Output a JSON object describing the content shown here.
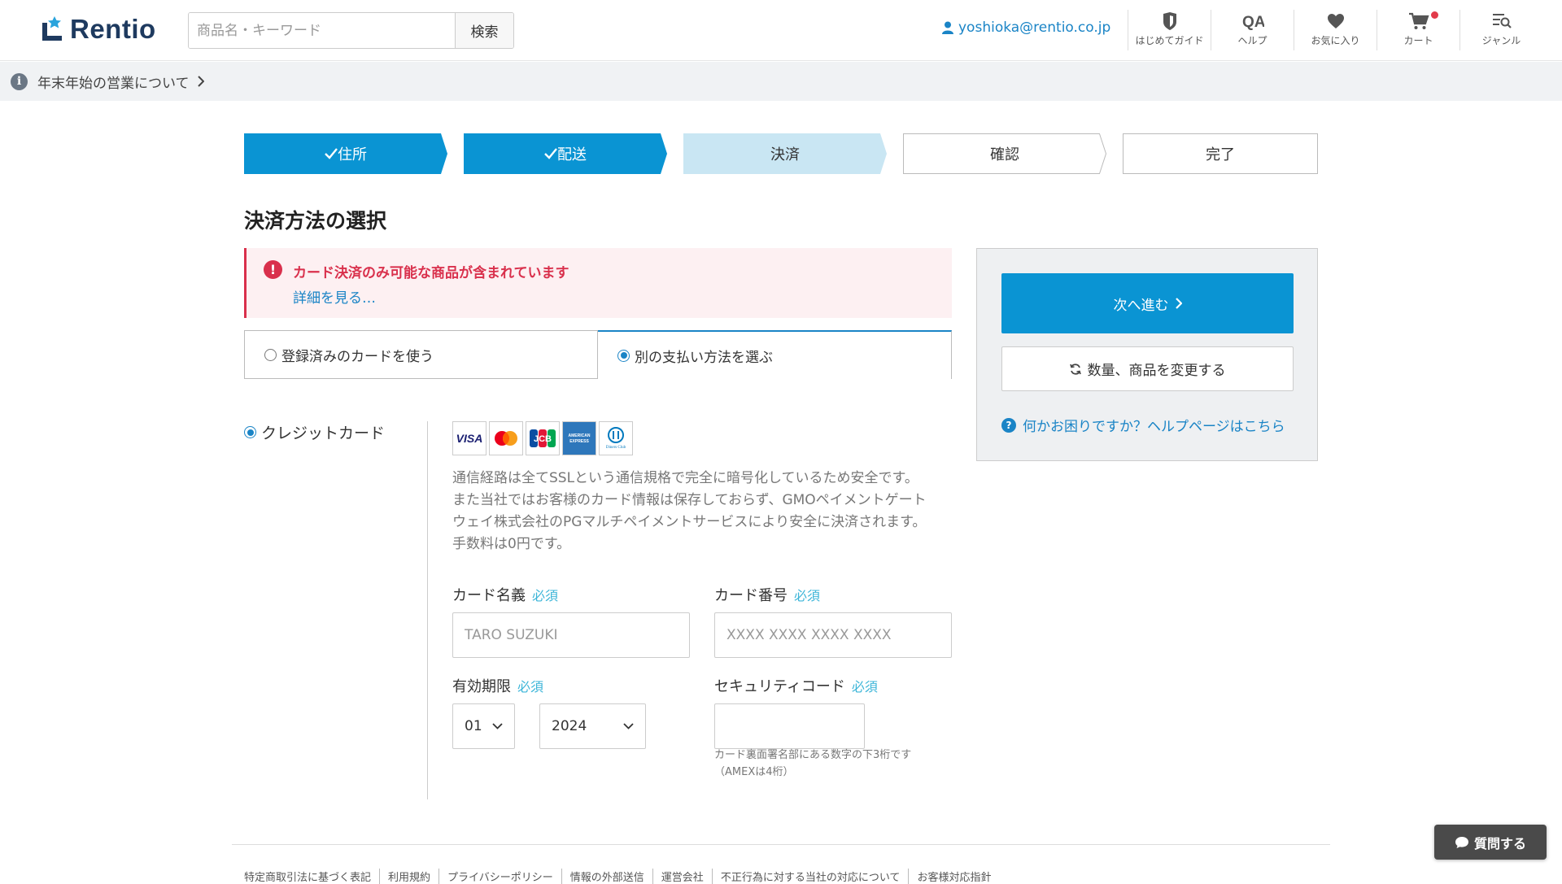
{
  "header": {
    "logo_text": "Rentio",
    "search_placeholder": "商品名・キーワード",
    "search_button": "検索",
    "user_email": "yoshioka@rentio.co.jp",
    "nav": [
      {
        "label": "はじめてガイド",
        "icon": "guide-shield-icon"
      },
      {
        "label": "ヘルプ",
        "icon": "qa-icon"
      },
      {
        "label": "お気に入り",
        "icon": "heart-icon"
      },
      {
        "label": "カート",
        "icon": "cart-icon",
        "badge": true
      },
      {
        "label": "ジャンル",
        "icon": "genre-list-icon"
      }
    ]
  },
  "notice": {
    "text": "年末年始の営業について"
  },
  "steps": [
    {
      "label": "住所",
      "state": "done"
    },
    {
      "label": "配送",
      "state": "done"
    },
    {
      "label": "決済",
      "state": "current"
    },
    {
      "label": "確認",
      "state": "todo"
    },
    {
      "label": "完了",
      "state": "todo"
    }
  ],
  "page_title": "決済方法の選択",
  "alert": {
    "title": "カード決済のみ可能な商品が含まれています",
    "link": "詳細を見る…"
  },
  "tabs": [
    {
      "label": "登録済みのカードを使う",
      "selected": false
    },
    {
      "label": "別の支払い方法を選ぶ",
      "selected": true
    }
  ],
  "method": {
    "label": "クレジットカード",
    "selected": true
  },
  "card_brands": [
    "VISA",
    "Mastercard",
    "JCB",
    "AMERICAN EXPRESS",
    "Diners Club"
  ],
  "description": [
    "通信経路は全てSSLという通信規格で完全に暗号化しているため安全です。",
    "また当社ではお客様のカード情報は保存しておらず、GMOペイメントゲート",
    "ウェイ株式会社のPGマルチペイメントサービスにより安全に決済されます。",
    "手数料は0円です。"
  ],
  "form": {
    "required_label": "必須",
    "card_name": {
      "label": "カード名義",
      "placeholder": "TARO SUZUKI",
      "value": ""
    },
    "card_number": {
      "label": "カード番号",
      "placeholder": "XXXX XXXX XXXX XXXX",
      "value": ""
    },
    "expiry": {
      "label": "有効期限",
      "month": "01",
      "year": "2024"
    },
    "security": {
      "label": "セキュリティコード",
      "value": "",
      "hint_line1": "カード裏面署名部にある数字の下3桁です",
      "hint_line2": "（AMEXは4桁）"
    }
  },
  "sidebar": {
    "next_button": "次へ進む",
    "change_button": "数量、商品を変更する",
    "help_link": "何かお困りですか？ヘルプページはこちら"
  },
  "footer": {
    "links": [
      "特定商取引法に基づく表記",
      "利用規約",
      "プライバシーポリシー",
      "情報の外部送信",
      "運営会社",
      "不正行為に対する当社の対応について",
      "お客様対応指針"
    ]
  },
  "question_button": "質問する",
  "colors": {
    "primary": "#0a94d3",
    "link": "#1a84c6",
    "alert": "#d9304c",
    "step_current": "#c9e6f3"
  }
}
